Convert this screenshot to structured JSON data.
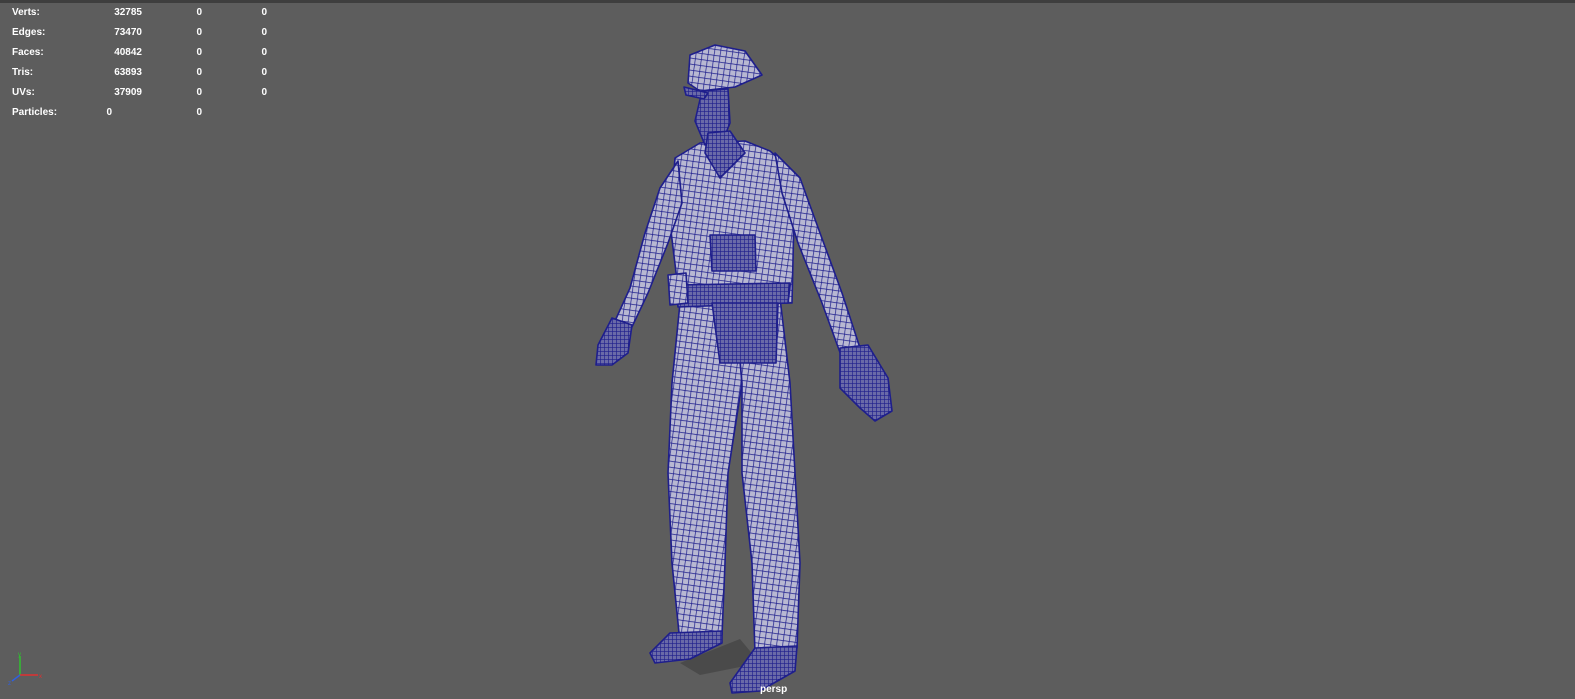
{
  "hud": {
    "rows": [
      {
        "label": "Verts:",
        "c1": "32785",
        "c2": "0",
        "c3": "0"
      },
      {
        "label": "Edges:",
        "c1": "73470",
        "c2": "0",
        "c3": "0"
      },
      {
        "label": "Faces:",
        "c1": "40842",
        "c2": "0",
        "c3": "0"
      },
      {
        "label": "Tris:",
        "c1": "63893",
        "c2": "0",
        "c3": "0"
      },
      {
        "label": "UVs:",
        "c1": "37909",
        "c2": "0",
        "c3": "0"
      },
      {
        "label": "Particles:",
        "c1": "0",
        "c2": "0"
      }
    ]
  },
  "viewport": {
    "camera": "persp",
    "background_color": "#5d5d5d",
    "wire_color": "#1e1e8c"
  },
  "axis_gizmo": {
    "x_color": "#e03030",
    "y_color": "#30c030",
    "z_color": "#3060e0"
  }
}
